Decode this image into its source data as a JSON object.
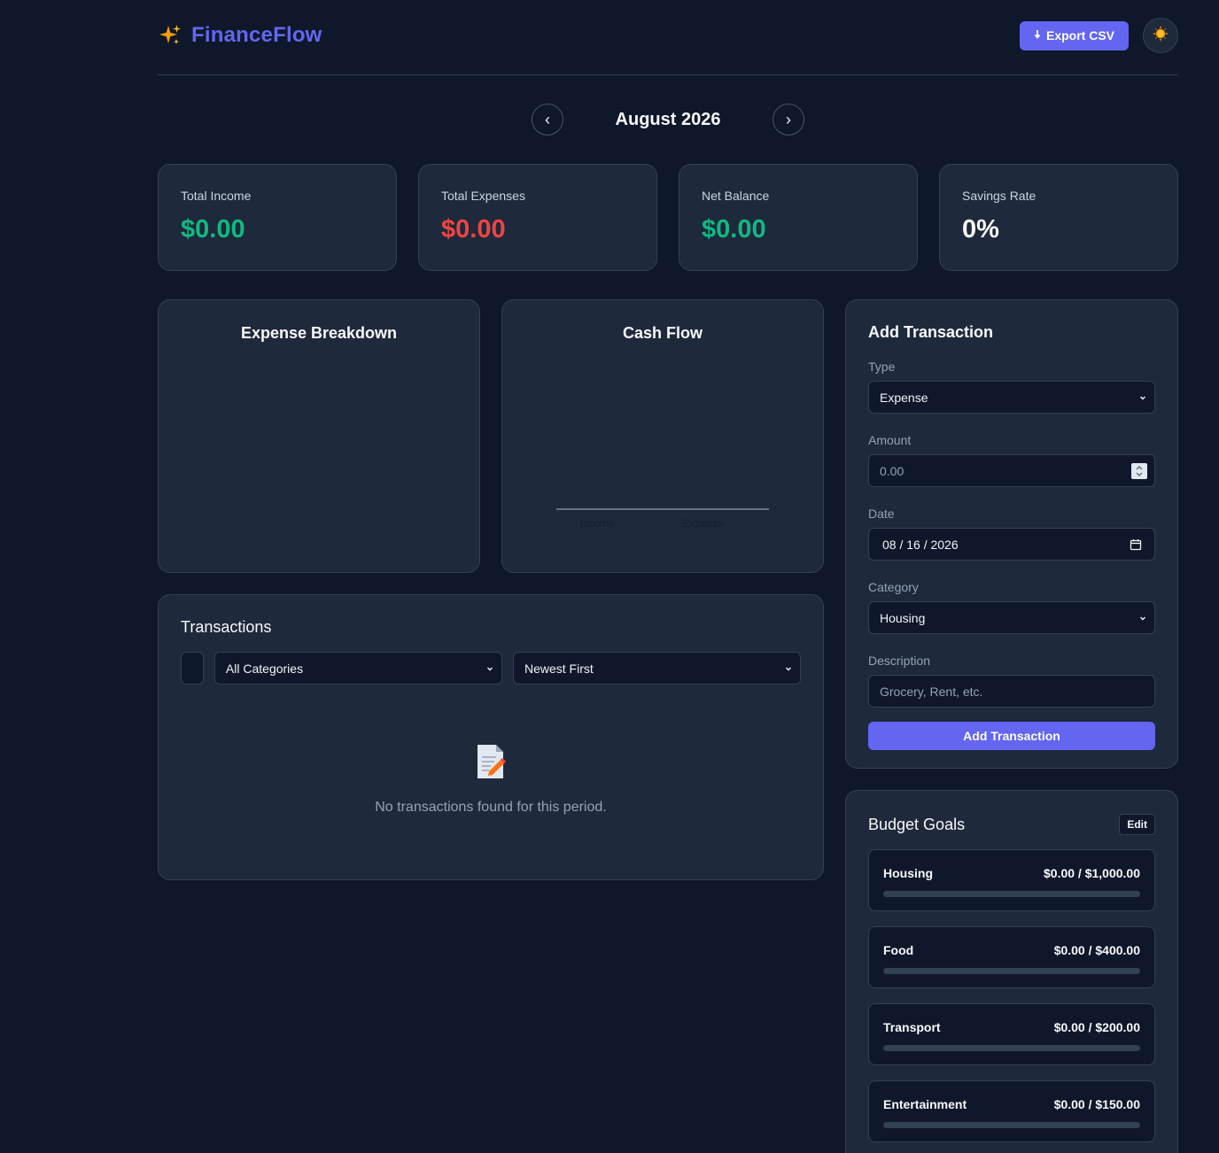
{
  "header": {
    "brand_name": "FinanceFlow",
    "export_label": "Export CSV"
  },
  "month_nav": {
    "label": "August 2026",
    "prev": "‹",
    "next": "›"
  },
  "stats": [
    {
      "label": "Total Income",
      "value": "$0.00",
      "color": "#10b981"
    },
    {
      "label": "Total Expenses",
      "value": "$0.00",
      "color": "#ef4444"
    },
    {
      "label": "Net Balance",
      "value": "$0.00",
      "color": "#10b981"
    },
    {
      "label": "Savings Rate",
      "value": "0%",
      "color": "#f8fafc"
    }
  ],
  "charts": {
    "expense_title": "Expense Breakdown",
    "cashflow_title": "Cash Flow"
  },
  "chart_data": {
    "type": "bar",
    "title": "Cash Flow",
    "categories": [
      "Income",
      "Expense"
    ],
    "values": [
      0,
      0
    ]
  },
  "transactions": {
    "title": "Transactions",
    "category_filter": "All Categories",
    "sort": "Newest First",
    "empty_text": "No transactions found for this period."
  },
  "form": {
    "title": "Add Transaction",
    "type_label": "Type",
    "type_value": "Expense",
    "amount_label": "Amount",
    "amount_placeholder": "0.00",
    "date_label": "Date",
    "date_value": "08 / 16 / 2026",
    "category_label": "Category",
    "category_value": "Housing",
    "description_label": "Description",
    "description_placeholder": "Grocery, Rent, etc.",
    "submit_label": "Add Transaction"
  },
  "budget": {
    "title": "Budget Goals",
    "edit_label": "Edit",
    "items": [
      {
        "name": "Housing",
        "amount": "$0.00 / $1,000.00",
        "progress": 0
      },
      {
        "name": "Food",
        "amount": "$0.00 / $400.00",
        "progress": 0
      },
      {
        "name": "Transport",
        "amount": "$0.00 / $200.00",
        "progress": 0
      },
      {
        "name": "Entertainment",
        "amount": "$0.00 / $150.00",
        "progress": 0
      }
    ]
  },
  "colors": {
    "accent": "#6366f1",
    "income": "#10b981",
    "expense": "#ef4444",
    "background": "#0f172a",
    "card": "#1e293b"
  }
}
